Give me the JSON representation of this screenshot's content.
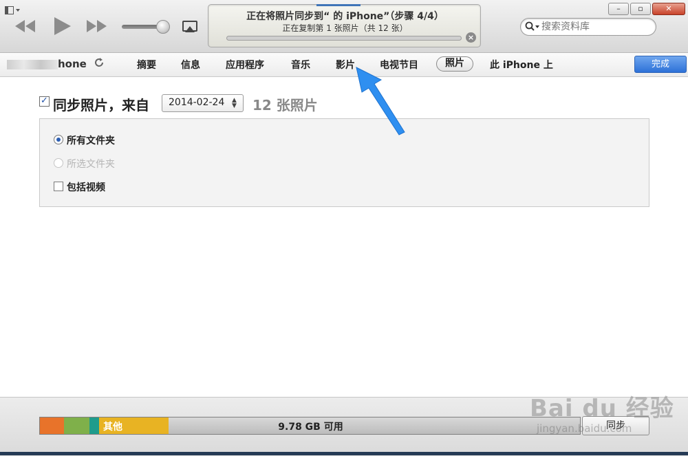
{
  "toolbar": {
    "menu_icon": "sidebar-menu-icon",
    "lcd": {
      "title": "正在将照片同步到“       的 iPhone”（步骤 4/4）",
      "subtitle": "正在复制第 1 张照片（共 12 张）",
      "progress": 0.0
    },
    "search_placeholder": "搜索资料库",
    "window_buttons": [
      "minimize",
      "maximize",
      "close"
    ]
  },
  "navbar": {
    "device_name": "hone",
    "tabs": [
      "摘要",
      "信息",
      "应用程序",
      "音乐",
      "影片",
      "电视节目",
      "照片",
      "此 iPhone 上"
    ],
    "active_tab": "照片",
    "done_label": "完成"
  },
  "content": {
    "sync_checked": true,
    "sync_label": "同步照片，来自",
    "date_value": "2014-02-24",
    "photo_count": "12 张照片",
    "options": {
      "all_folders": "所有文件夹",
      "selected_folders": "所选文件夹",
      "include_videos": "包括视频"
    }
  },
  "bottom": {
    "other_label": "其他",
    "free_label": "9.78 GB 可用",
    "sync_label": "同步",
    "segments_colors": [
      "#e8732a",
      "#7fb04a",
      "#1f9c8c",
      "#e8b323"
    ]
  },
  "watermark": {
    "logo": "Bai du 经验",
    "url": "jingyan.baidu.com"
  },
  "colors": {
    "accent_blue": "#2d71d8",
    "arrow_blue": "#2f8ff0"
  }
}
